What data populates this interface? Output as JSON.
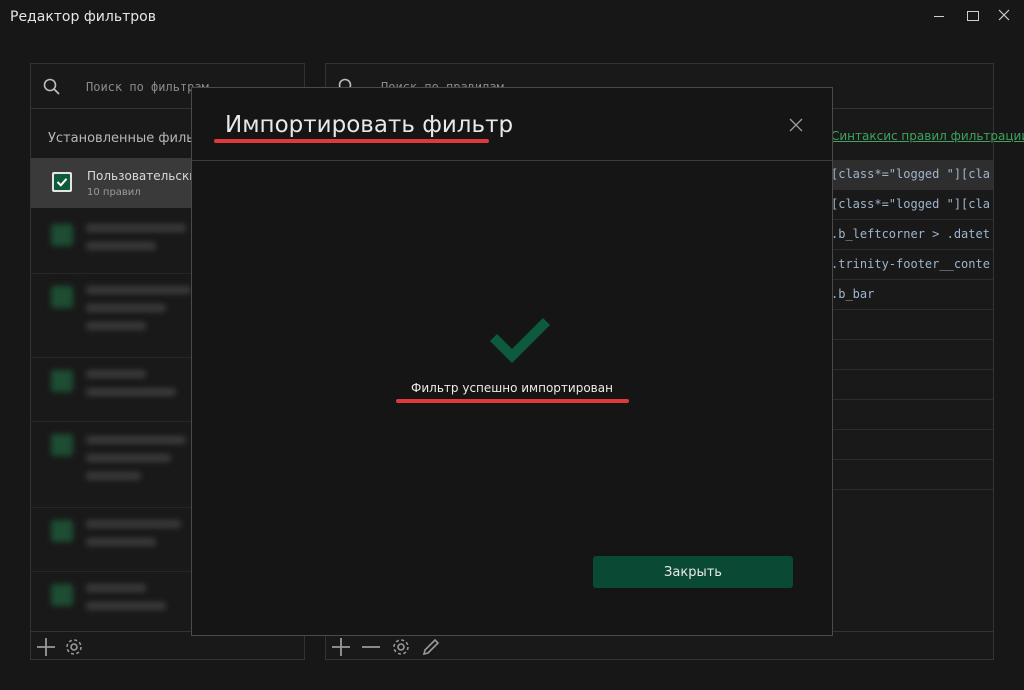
{
  "window": {
    "title": "Редактор фильтров"
  },
  "colors": {
    "accent_green": "#0a4a34",
    "check_green": "#0e5a3c",
    "link_green": "#3fa35e",
    "highlight_red": "#e0393c",
    "background": "#171717"
  },
  "filters_panel": {
    "search_placeholder": "Поиск по фильтрам",
    "section_title": "Установленные фильтры",
    "active_filter": {
      "name": "Пользовательский",
      "count": "10 правил",
      "checked": true
    }
  },
  "rules_panel": {
    "search_placeholder": "Поиск по правилам",
    "syntax_link": "Синтаксис правил фильтрации",
    "rules": [
      "[class*=\"logged \"][class*=\"",
      "[class*=\"logged \"][class*=\"",
      ".b_leftcorner > .dateti",
      ".trinity-footer__content",
      ".b_bar",
      "",
      "",
      "",
      "",
      "",
      ""
    ]
  },
  "dialog": {
    "title": "Импортировать фильтр",
    "message": "Фильтр успешно импортирован",
    "close_button": "Закрыть"
  }
}
